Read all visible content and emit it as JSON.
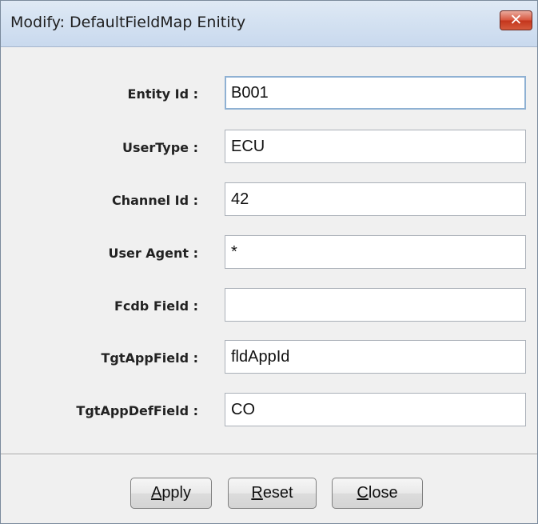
{
  "window": {
    "title": "Modify:  DefaultFieldMap Enitity",
    "close_glyph": "✕"
  },
  "form": {
    "fields": [
      {
        "label": "Entity Id :",
        "value": "B001"
      },
      {
        "label": "UserType :",
        "value": "ECU"
      },
      {
        "label": "Channel Id :",
        "value": "42"
      },
      {
        "label": "User Agent :",
        "value": "*"
      },
      {
        "label": "Fcdb Field :",
        "value": ""
      },
      {
        "label": "TgtAppField :",
        "value": "fldAppId"
      },
      {
        "label": "TgtAppDefField :",
        "value": "CO"
      }
    ]
  },
  "buttons": {
    "apply": {
      "mnemonic": "A",
      "rest": "pply"
    },
    "reset": {
      "mnemonic": "R",
      "rest": "eset"
    },
    "close": {
      "mnemonic": "C",
      "rest": "lose"
    }
  }
}
